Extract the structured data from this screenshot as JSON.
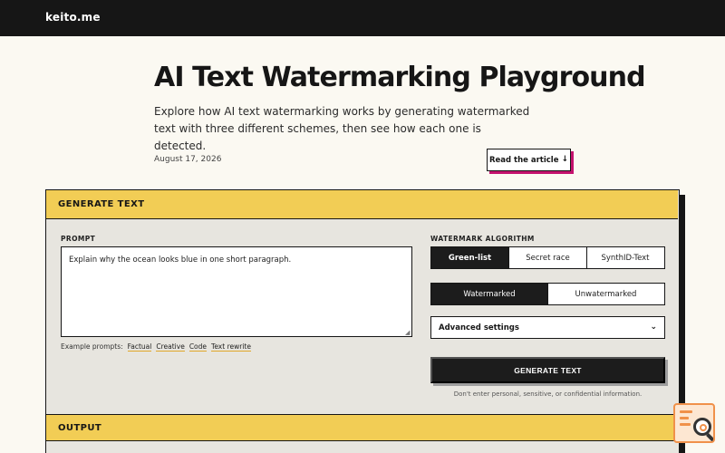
{
  "site": {
    "brand": "keito.me"
  },
  "hero": {
    "title": "AI Text Watermarking Playground",
    "subtitle": "Explore how AI text watermarking works by generating watermarked text with three different schemes, then see how each one is detected.",
    "date": "August 17, 2026",
    "article_button": "Read the article",
    "article_icon": "arrow-down-icon"
  },
  "generate": {
    "header": "GENERATE TEXT",
    "prompt_label": "PROMPT",
    "prompt_value": "Explain why the ocean looks blue in one short paragraph.",
    "examples_label": "Example prompts:",
    "examples": [
      "Factual",
      "Creative",
      "Code",
      "Text rewrite"
    ],
    "algorithm_label": "WATERMARK ALGORITHM",
    "algorithms": [
      "Green-list",
      "Secret race",
      "SynthID-Text"
    ],
    "algorithm_selected": "Green-list",
    "modes": [
      "Watermarked",
      "Unwatermarked"
    ],
    "mode_selected": "Watermarked",
    "advanced_label": "Advanced settings",
    "generate_button": "GENERATE TEXT",
    "disclaimer": "Don't enter personal, sensitive, or confidential information."
  },
  "output": {
    "header": "OUTPUT"
  },
  "colors": {
    "accent_yellow": "#f2cd55",
    "ink": "#161616",
    "magenta_shadow": "#c4126e",
    "page_bg": "#fbf9f2",
    "panel_bg": "#e7e5df",
    "widget_orange": "#f0914a"
  }
}
